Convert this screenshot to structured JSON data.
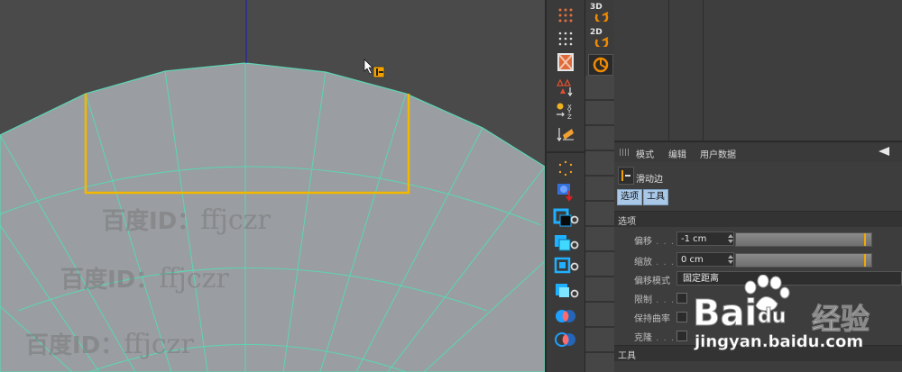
{
  "tool_column": {
    "icons": [
      "points-mode-icon",
      "edges-grid-icon",
      "polygon-icon",
      "texture-tag-icon",
      "axis-icon",
      "move-axis-icon",
      "snap-icon",
      "cube-icon",
      "bevel-icon",
      "bend-icon",
      "twist-icon",
      "boolean-icon",
      "symmetry-icon"
    ]
  },
  "mode_column": {
    "label_3d": "3D",
    "label_2d": "2D"
  },
  "attributes": {
    "menu": {
      "mode": "模式",
      "edit": "编辑",
      "user_data": "用户数据"
    },
    "tool_name": "滑动边",
    "tabs": {
      "options": "选项",
      "tools": "工具"
    },
    "section_options": "选项",
    "offset": {
      "label": "偏移",
      "value": "-1 cm",
      "fill": 0.96
    },
    "scale": {
      "label": "缩放",
      "value": "0 cm",
      "fill": 0.96
    },
    "offset_mode": {
      "label": "偏移模式",
      "value": "固定距离"
    },
    "limit": {
      "label": "限制"
    },
    "preserve_curvature": {
      "label": "保持曲率"
    },
    "clone": {
      "label": "克隆"
    },
    "section_tools": "工具"
  },
  "watermark": {
    "line1": "百度ID：",
    "id": "ffjczr",
    "baidu_text": "Bai",
    "baidu_du": "du",
    "baidu_jy": "经验",
    "baidu_url": "jingyan.baidu.com"
  },
  "colors": {
    "mesh_fill": "#9a9da1",
    "wire": "#5fd3b3",
    "selection": "#f2b800",
    "axis_blue": "#2a2a9a"
  }
}
